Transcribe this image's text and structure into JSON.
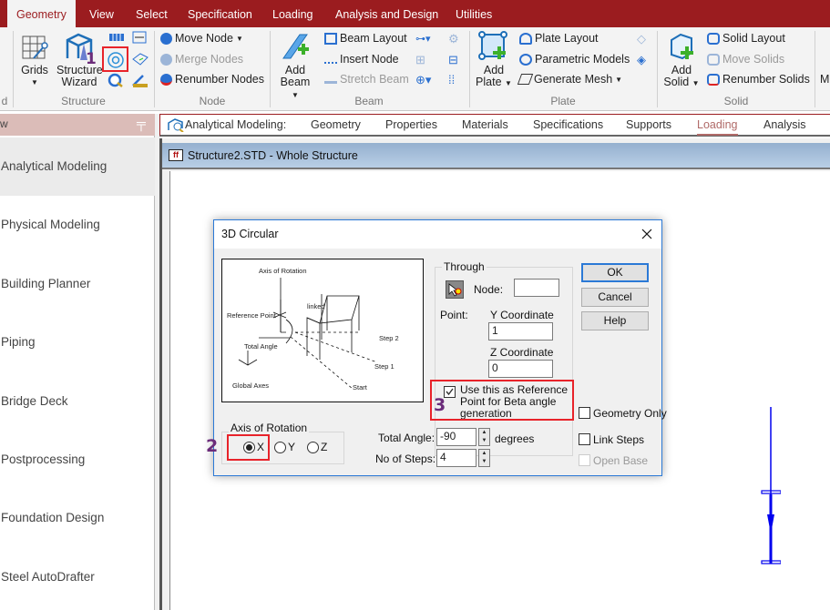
{
  "menu_tabs": [
    "Geometry",
    "View",
    "Select",
    "Specification",
    "Loading",
    "Analysis and Design",
    "Utilities"
  ],
  "ribbon": {
    "structure": {
      "grids": "Grids",
      "structure_wizard": "Structure Wizard",
      "group": "Structure"
    },
    "node": {
      "move": "Move Node",
      "merge": "Merge Nodes",
      "renumber": "Renumber Nodes",
      "group": "Node"
    },
    "beam": {
      "add": "Add Beam",
      "layout": "Beam Layout",
      "insert": "Insert Node",
      "stretch": "Stretch Beam",
      "group": "Beam"
    },
    "plate": {
      "add": "Add Plate",
      "layout": "Plate Layout",
      "parametric": "Parametric Models",
      "mesh": "Generate Mesh",
      "group": "Plate"
    },
    "solid": {
      "add": "Add Solid",
      "layout": "Solid Layout",
      "move": "Move Solids",
      "renumber": "Renumber Solids",
      "group": "Solid"
    },
    "more_cut": "M",
    "left_cut_group": "d"
  },
  "sidebar": {
    "header": "w",
    "items": [
      "Analytical Modeling",
      "Physical Modeling",
      "Building Planner",
      "Piping",
      "Bridge Deck",
      "Postprocessing",
      "Foundation Design",
      "Steel AutoDrafter"
    ],
    "selected": 0
  },
  "modebar": {
    "label": "Analytical Modeling:",
    "items": [
      "Geometry",
      "Properties",
      "Materials",
      "Specifications",
      "Supports",
      "Loading",
      "Analysis"
    ],
    "active": "Loading"
  },
  "document": {
    "title": "Structure2.STD - Whole Structure"
  },
  "dialog": {
    "title": "3D Circular",
    "diagram_labels": {
      "axis": "Axis of Rotation",
      "ref": "Reference Point",
      "linked": "linked",
      "total": "Total Angle",
      "step2": "Step 2",
      "step1": "Step 1",
      "start": "Start",
      "global": "Global Axes"
    },
    "through": {
      "caption": "Through",
      "node_label": "Node:",
      "node_value": "",
      "point_label": "Point:",
      "y_label": "Y Coordinate",
      "y_value": "1",
      "z_label": "Z Coordinate",
      "z_value": "0"
    },
    "ref_checkbox": {
      "label": "Use this as Reference Point for Beta angle generation",
      "checked": true
    },
    "axis": {
      "caption": "Axis of Rotation",
      "options": [
        "X",
        "Y",
        "Z"
      ],
      "selected": "X"
    },
    "total_angle": {
      "label": "Total Angle:",
      "value": "-90",
      "unit": "degrees"
    },
    "steps": {
      "label": "No of Steps:",
      "value": "4"
    },
    "buttons": {
      "ok": "OK",
      "cancel": "Cancel",
      "help": "Help"
    },
    "geometry_only": {
      "label": "Geometry Only",
      "checked": false
    },
    "link_steps": {
      "label": "Link Steps",
      "checked": false
    },
    "open_base": {
      "label": "Open Base",
      "checked": false,
      "disabled": true
    }
  },
  "annotations": [
    "1",
    "2",
    "3"
  ],
  "colors": {
    "brand": "#9b1c1f",
    "highlight": "#e8232a",
    "annotation": "#6b2c7a",
    "structure": "#0000ee"
  }
}
